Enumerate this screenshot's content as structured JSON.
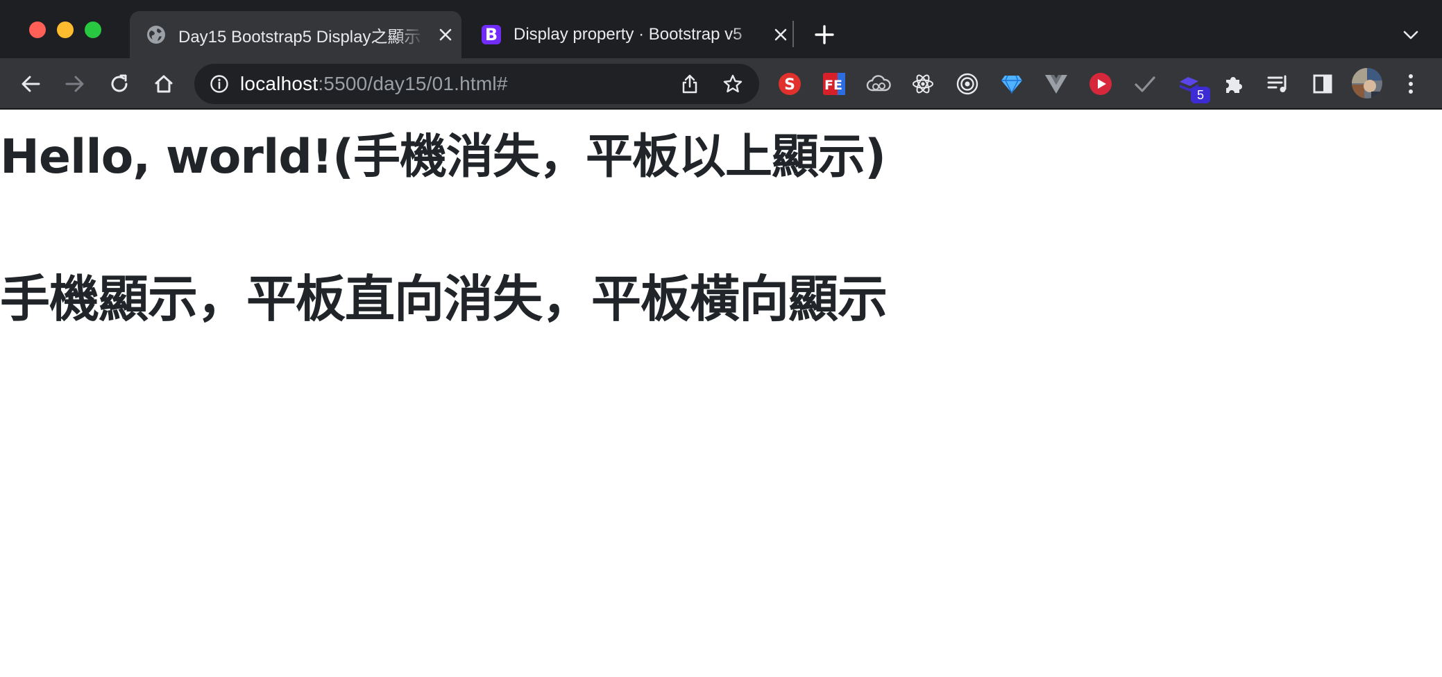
{
  "browser": {
    "tabs": [
      {
        "title": "Day15 Bootstrap5 Display之顯示",
        "icon": "globe-icon",
        "active": true
      },
      {
        "title": "Display property · Bootstrap v5",
        "icon": "bootstrap-icon",
        "favicon_letter": "B",
        "active": false
      }
    ],
    "address_bar": {
      "host": "localhost",
      "path": ":5500/day15/01.html#"
    },
    "extensions": [
      {
        "name": "s-extension-icon",
        "letter": "S",
        "color": "#e0312d"
      },
      {
        "name": "fe-extension-icon",
        "letter": "FE",
        "color": "#d6212b"
      },
      {
        "name": "cloud-extension-icon"
      },
      {
        "name": "react-devtools-icon"
      },
      {
        "name": "target-extension-icon"
      },
      {
        "name": "gem-extension-icon"
      },
      {
        "name": "vue-devtools-icon"
      },
      {
        "name": "youtube-play-icon"
      },
      {
        "name": "checkmark-extension-icon"
      },
      {
        "name": "stack-extension-icon",
        "badge": "5"
      },
      {
        "name": "puzzle-extensions-icon"
      },
      {
        "name": "reading-list-icon"
      },
      {
        "name": "side-panel-icon"
      }
    ],
    "colors": {
      "tabstrip": "#1e1f22",
      "toolbar": "#35363a",
      "bootstrap_purple": "#712cf9"
    }
  },
  "page": {
    "heading1": "Hello, world!(手機消失，平板以上顯示)",
    "heading2": "手機顯示，平板直向消失，平板橫向顯示"
  }
}
